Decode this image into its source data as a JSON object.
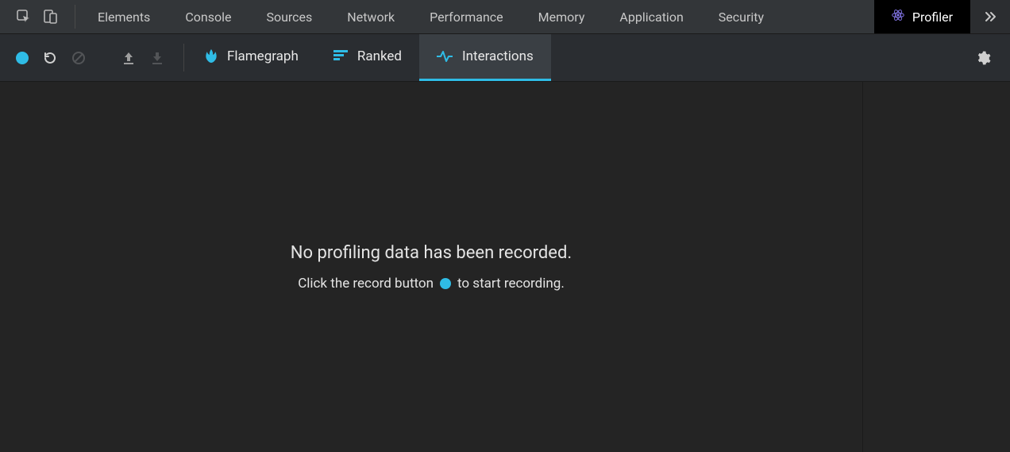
{
  "colors": {
    "accent": "#2fbce6",
    "bg": "#242424",
    "bar": "#2a2d31",
    "topbar": "#333639",
    "active_tab_bg": "#000000"
  },
  "top_tabs": {
    "items": [
      {
        "label": "Elements"
      },
      {
        "label": "Console"
      },
      {
        "label": "Sources"
      },
      {
        "label": "Network"
      },
      {
        "label": "Performance"
      },
      {
        "label": "Memory"
      },
      {
        "label": "Application"
      },
      {
        "label": "Security"
      },
      {
        "label": "Profiler"
      }
    ],
    "active_index": 8
  },
  "profiler": {
    "views": [
      {
        "label": "Flamegraph"
      },
      {
        "label": "Ranked"
      },
      {
        "label": "Interactions"
      }
    ],
    "active_view_index": 2,
    "empty_title": "No profiling data has been recorded.",
    "empty_hint_before": "Click the record button",
    "empty_hint_after": "to start recording."
  }
}
